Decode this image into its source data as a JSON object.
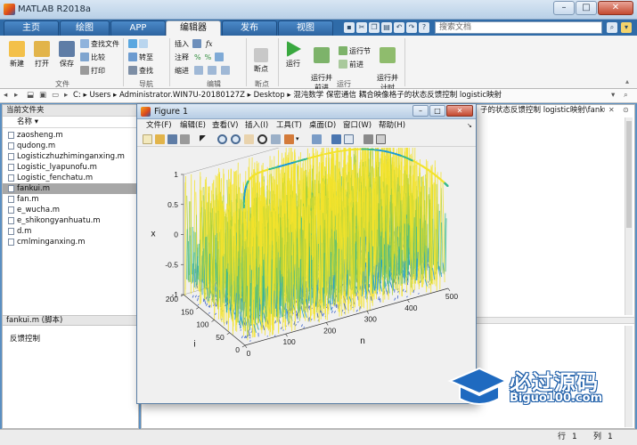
{
  "window": {
    "title": "MATLAB R2018a"
  },
  "tabs": [
    "主页",
    "绘图",
    "APP",
    "编辑器",
    "发布",
    "视图"
  ],
  "search_placeholder": "搜索文档",
  "ribbon": {
    "file_group": {
      "label": "文件",
      "new": "新建",
      "open": "打开",
      "save": "保存",
      "find_files": "查找文件",
      "compare": "比较",
      "print": "打印"
    },
    "nav_group": {
      "label": "导航",
      "goto": "转至",
      "find": "查找"
    },
    "edit_group": {
      "label": "编辑",
      "insert": "插入",
      "comment": "注释",
      "indent": "缩进"
    },
    "breakpoint_group": {
      "label": "断点",
      "breakpoints": "断点"
    },
    "run_group": {
      "label": "运行",
      "run": "运行",
      "run_advance": "运行并\n前进",
      "run_section": "运行节",
      "advance": "前进",
      "run_time": "运行并\n计时"
    }
  },
  "address": {
    "path": [
      "C:",
      "Users",
      "Administrator.WIN7U-20180127Z",
      "Desktop",
      "混沌数学 保密通信 耦合映像格子的状态反馈控制 logistic映射"
    ]
  },
  "current_folder": {
    "title": "当前文件夹",
    "column": "名称",
    "files": [
      "zaosheng.m",
      "qudong.m",
      "Logisticzhuzhiminganxing.m",
      "Logistic_lyapunofu.m",
      "Logistic_fenchatu.m",
      "fankui.m",
      "fan.m",
      "e_wucha.m",
      "e_shikongyanhuatu.m",
      "d.m",
      "cmlminganxing.m"
    ],
    "selected": "fankui.m",
    "details_title": "fankui.m  (脚本)",
    "details_text": "反馈控制"
  },
  "editor_title": "子的状态反馈控制 logistic映射\\fanku...",
  "figure": {
    "title": "Figure 1",
    "menu": [
      "文件(F)",
      "编辑(E)",
      "查看(V)",
      "插入(I)",
      "工具(T)",
      "桌面(D)",
      "窗口(W)",
      "帮助(H)"
    ]
  },
  "chart_data": {
    "type": "surface",
    "zlabel": "x",
    "xlabel": "n",
    "ylabel": "i",
    "z_ticks": [
      "-1",
      "-0.5",
      "0",
      "0.5",
      "1"
    ],
    "n_ticks": [
      "0",
      "100",
      "200",
      "300",
      "400",
      "500"
    ],
    "i_ticks": [
      "0",
      "50",
      "100",
      "150",
      "200"
    ],
    "zlim": [
      -1,
      1
    ],
    "n_range": [
      0,
      500
    ],
    "i_range": [
      0,
      200
    ],
    "colormap": [
      "#2b56c8",
      "#1a9ad8",
      "#37b98e",
      "#a9cf3c",
      "#f3e32c"
    ]
  },
  "statusbar": {
    "row_label": "行",
    "row": "1",
    "col_label": "列",
    "col": "1"
  },
  "watermark": {
    "text": "必过源码",
    "sub": "Biguo100.com"
  }
}
